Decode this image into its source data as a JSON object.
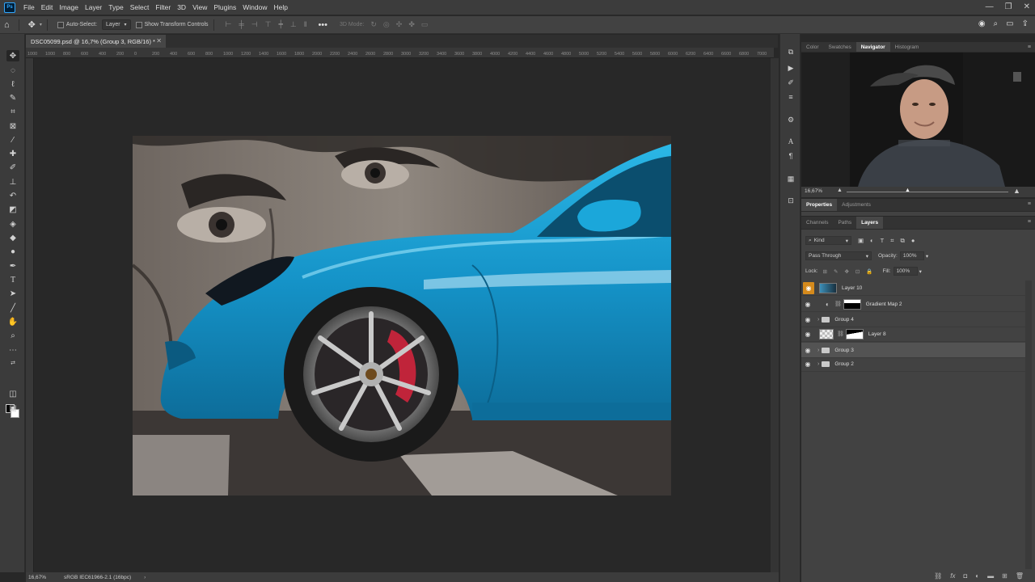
{
  "app": {
    "logo_text": "Ps"
  },
  "menu": [
    "File",
    "Edit",
    "Image",
    "Layer",
    "Type",
    "Select",
    "Filter",
    "3D",
    "View",
    "Plugins",
    "Window",
    "Help"
  ],
  "options_bar": {
    "auto_select_label": "Auto-Select:",
    "auto_select_value": "Layer",
    "show_transform_label": "Show Transform Controls",
    "mode_3d_label": "3D Mode:"
  },
  "document": {
    "tab_title": "DSC05099.psd @ 16,7% (Group 3, RGB/16) *",
    "ruler_ticks": [
      "1000",
      "1000",
      "800",
      "600",
      "400",
      "200",
      "0",
      "200",
      "400",
      "600",
      "800",
      "1000",
      "1200",
      "1400",
      "1600",
      "1800",
      "2000",
      "2200",
      "2400",
      "2600",
      "2800",
      "3000",
      "3200",
      "3400",
      "3600",
      "3800",
      "4000",
      "4200",
      "4400",
      "4600",
      "4800",
      "5000",
      "5200",
      "5400",
      "5600",
      "5800",
      "6000",
      "6200",
      "6400",
      "6600",
      "6800",
      "7000"
    ]
  },
  "status": {
    "zoom": "16,67%",
    "profile": "sRGB IEC61966-2.1 (16bpc)"
  },
  "top_panel": {
    "tabs": [
      "Color",
      "Swatches",
      "Navigator",
      "Histogram"
    ],
    "active": "Navigator",
    "zoom": "16,67%"
  },
  "properties_panel": {
    "tabs": [
      "Properties",
      "Adjustments"
    ],
    "active": "Properties"
  },
  "layers_panel": {
    "tabs": [
      "Channels",
      "Paths",
      "Layers"
    ],
    "active": "Layers",
    "filter_kind": "Kind",
    "blend_mode": "Pass Through",
    "opacity_label": "Opacity:",
    "opacity_value": "100%",
    "lock_label": "Lock:",
    "fill_label": "Fill:",
    "fill_value": "100%",
    "layers": [
      {
        "name": "Layer 10",
        "type": "image"
      },
      {
        "name": "Gradient Map 2",
        "type": "adjustment"
      },
      {
        "name": "Group 4",
        "type": "group"
      },
      {
        "name": "Layer 8",
        "type": "masked"
      },
      {
        "name": "Group 3",
        "type": "group",
        "selected": true
      },
      {
        "name": "Group 2",
        "type": "group"
      }
    ]
  },
  "colors": {
    "accent_eye": "#d58a1c",
    "car_blue": "#1aa6d8",
    "caliper_red": "#c0243a"
  }
}
